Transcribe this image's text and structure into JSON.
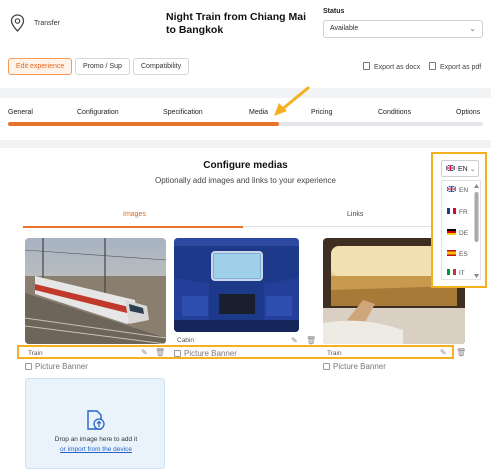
{
  "header": {
    "type_label": "Transfer",
    "title": "Night Train from Chiang Mai to Bangkok",
    "status_label": "Status",
    "status_value": "Available"
  },
  "actions": {
    "edit": "Edit experience",
    "promo": "Promo / Sup",
    "compat": "Compatibility",
    "export_docx": "Export as docx",
    "export_pdf": "Export as pdf"
  },
  "steps": {
    "items": [
      "General",
      "Configuration",
      "Specification",
      "Media",
      "Pricing",
      "Conditions",
      "Options"
    ],
    "active": "Media",
    "progress_fraction": 0.57
  },
  "media": {
    "title": "Configure medias",
    "subtitle": "Optionally add images and links to your experience",
    "tabs": [
      "Images",
      "Links"
    ],
    "active_tab": "Images",
    "images": [
      {
        "caption": "Train",
        "picture_banner": "Picture Banner"
      },
      {
        "caption": "Cabin",
        "picture_banner": "Picture Banner"
      },
      {
        "caption": "Train",
        "picture_banner": "Picture Banner"
      }
    ],
    "drop_text": "Drop an image here to add it",
    "drop_link": "or import from the device"
  },
  "language": {
    "selected": "EN",
    "options": [
      "EN",
      "FR",
      "DE",
      "ES",
      "IT"
    ]
  },
  "colors": {
    "accent": "#e8732a",
    "highlight": "#f5b01f",
    "link": "#2563c7"
  }
}
